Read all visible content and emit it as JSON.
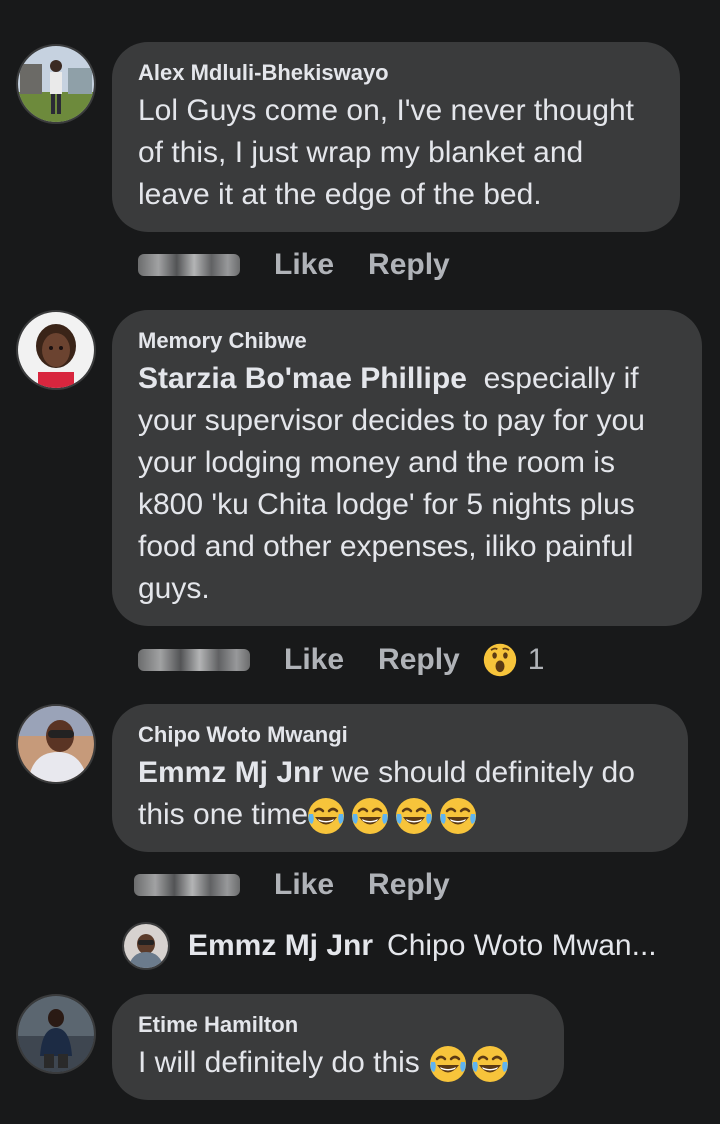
{
  "comments": [
    {
      "author": "Alex Mdluli-Bhekiswayo",
      "text": "Lol Guys come on, I've never thought of this, I just wrap my blanket and leave it at the edge of the bed.",
      "line1": "Lol Guys come on, I've never thought",
      "line2": "of this, I just wrap my blanket and",
      "line3": "leave it at the edge of the bed.",
      "like_label": "Like",
      "reply_label": "Reply"
    },
    {
      "author": "Memory Chibwe",
      "mention": "Starzia Bo'mae Phillipe",
      "line1_rest": "  especially if",
      "line2": "your supervisor decides to pay for you",
      "line3": "your lodging money and the room is",
      "line4": "k800 'ku Chita lodge' for 5 nights plus",
      "line5": "food and other expenses, iliko painful",
      "line6": "guys.",
      "like_label": "Like",
      "reply_label": "Reply",
      "reaction_icon": "wow-emoji-icon",
      "reaction_count": "1"
    },
    {
      "author": "Chipo Woto Mwangi",
      "mention": "Emmz Mj Jnr",
      "line1_rest": " we should definitely do",
      "line2": "this one time",
      "emoji_icon": "tears-of-joy-emoji-icon",
      "like_label": "Like",
      "reply_label": "Reply"
    },
    {
      "author": "Etime Hamilton",
      "line1": "I will definitely do this ",
      "emoji_icon": "tears-of-joy-emoji-icon"
    }
  ],
  "reply_preview": {
    "author": "Emmz Mj Jnr",
    "text": "Chipo Woto Mwan..."
  },
  "colors": {
    "background": "#18191a",
    "bubble": "#3a3b3c",
    "text": "#e4e6eb",
    "secondary": "#b0b3b8"
  }
}
